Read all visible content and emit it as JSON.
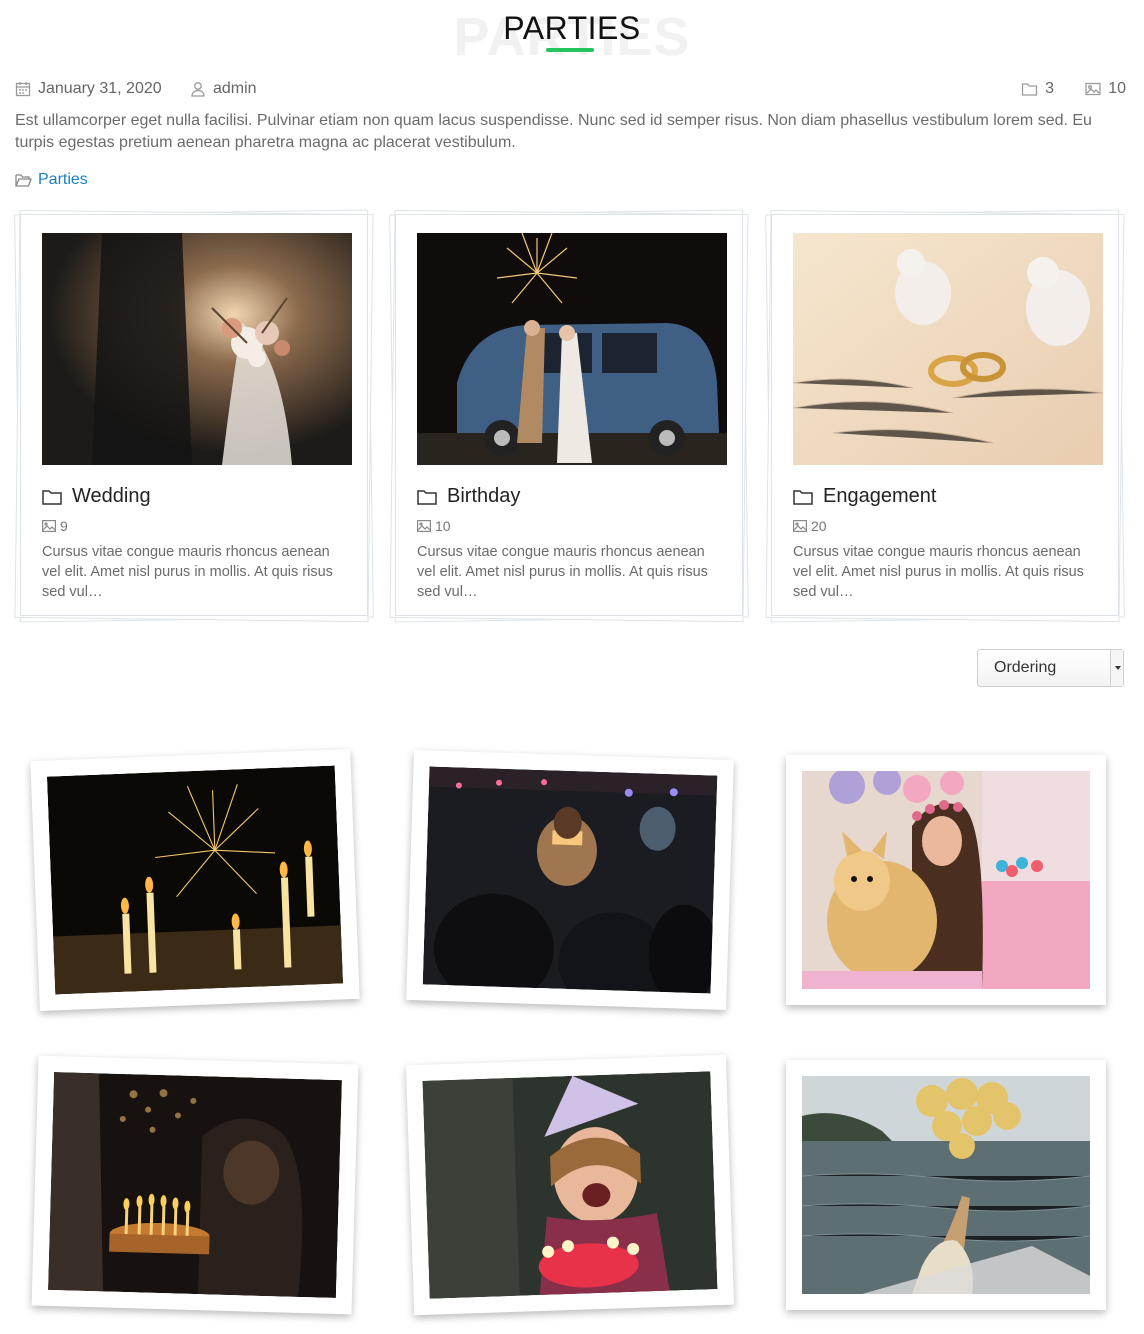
{
  "page": {
    "title": "PARTIES",
    "title_shadow": "PARTIES",
    "accent_color": "#22c55e",
    "link_color": "#1a7fc1"
  },
  "meta": {
    "date": "January 31, 2020",
    "author": "admin",
    "album_count": "3",
    "photo_count": "10"
  },
  "description": "Est ullamcorper eget nulla facilisi. Pulvinar etiam non quam lacus suspendisse. Nunc sed id semper risus. Non diam phasellus vestibulum lorem sed. Eu turpis egestas pretium aenean pharetra magna ac placerat vestibulum.",
  "category": {
    "label": "Parties",
    "icon": "folder-open-icon"
  },
  "albums": [
    {
      "title": "Wedding",
      "count": "9",
      "description": "Cursus vitae congue mauris rhoncus aenean vel elit. Amet nisl purus in mollis. At quis risus sed vul…"
    },
    {
      "title": "Birthday",
      "count": "10",
      "description": "Cursus vitae congue mauris rhoncus aenean vel elit. Amet nisl purus in mollis. At quis risus sed vul…"
    },
    {
      "title": "Engagement",
      "count": "20",
      "description": "Cursus vitae congue mauris rhoncus aenean vel elit. Amet nisl purus in mollis. At quis risus sed vul…"
    }
  ],
  "ordering": {
    "selected": "Ordering"
  },
  "photos": [
    {
      "icon": "sparkler-candles-photo"
    },
    {
      "icon": "party-cake-night-photo"
    },
    {
      "icon": "girl-with-dog-photo"
    },
    {
      "icon": "birthday-cake-candles-photo"
    },
    {
      "icon": "child-blowing-candles-photo"
    },
    {
      "icon": "balloons-boat-photo"
    }
  ]
}
